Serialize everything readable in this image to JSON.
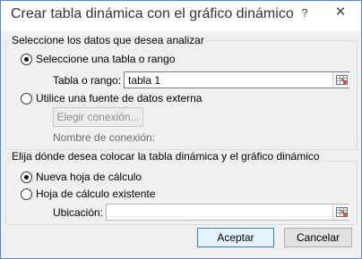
{
  "dialog": {
    "title": "Crear tabla dinámica con el gráfico dinámico",
    "help_glyph": "?",
    "close_glyph": "✕"
  },
  "data_source": {
    "group_title": "Seleccione los datos que desea analizar",
    "option_table": "Seleccione una tabla o rango",
    "option_table_selected": true,
    "table_range_label": "Tabla o rango:",
    "table_range_value": "tabla 1",
    "option_external": "Utilice una fuente de datos externa",
    "choose_connection_button": "Elegir conexión...",
    "connection_name_label": "Nombre de conexión:"
  },
  "placement": {
    "group_title": "Elija dónde desea colocar la tabla dinámica y el gráfico dinámico",
    "option_new_sheet": "Nueva hoja de cálculo",
    "option_new_sheet_selected": true,
    "option_existing_sheet": "Hoja de cálculo existente",
    "location_label": "Ubicación:",
    "location_value": ""
  },
  "buttons": {
    "accept": "Aceptar",
    "cancel": "Cancelar"
  },
  "icons": {
    "range_picker": "range-picker-icon"
  }
}
